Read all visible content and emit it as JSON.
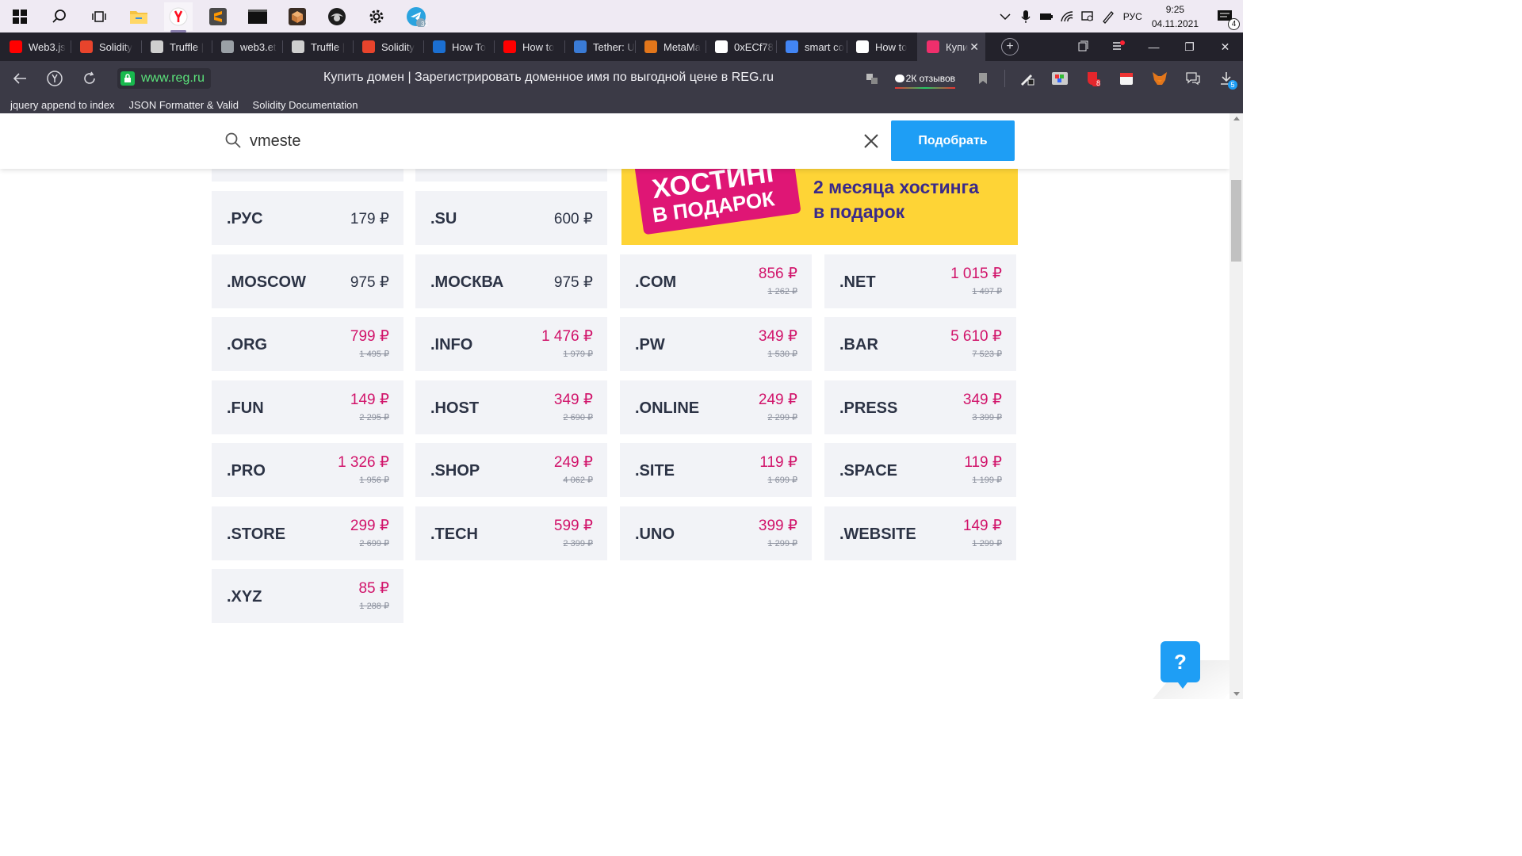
{
  "taskbar": {
    "icons": [
      "windows-start",
      "search",
      "task-view",
      "file-explorer",
      "yandex-browser",
      "sublime-text",
      "terminal",
      "package-app",
      "game-app",
      "settings",
      "telegram"
    ],
    "telegram_badge": "32",
    "tray": {
      "lang": "РУС",
      "time": "9:25",
      "date": "04.11.2021",
      "notifications": "4"
    }
  },
  "tabs": [
    {
      "title": "Web3.js",
      "icon": "youtube-icon",
      "color": "#ff0000"
    },
    {
      "title": "Solidity",
      "icon": "solidity-icon",
      "color": "#e8442c"
    },
    {
      "title": "Truffle |",
      "icon": "truffle-icon",
      "color": "#cfcfcf"
    },
    {
      "title": "web3.et",
      "icon": "doc-icon",
      "color": "#9aa0a6"
    },
    {
      "title": "Truffle |",
      "icon": "truffle-icon",
      "color": "#cfcfcf"
    },
    {
      "title": "Solidity",
      "icon": "solidity-icon",
      "color": "#e8442c"
    },
    {
      "title": "How To",
      "icon": "howto-icon",
      "color": "#1b6fd1"
    },
    {
      "title": "How to",
      "icon": "youtube-icon",
      "color": "#ff0000"
    },
    {
      "title": "Tether: U",
      "icon": "tether-icon",
      "color": "#3a7bd5"
    },
    {
      "title": "MetaMa",
      "icon": "metamask-icon",
      "color": "#e2761b"
    },
    {
      "title": "0xECf78",
      "icon": "ethereum-icon",
      "color": "#ffffff"
    },
    {
      "title": "smart co",
      "icon": "google-icon",
      "color": "#4285f4"
    },
    {
      "title": "How to",
      "icon": "medium-icon",
      "color": "#ffffff"
    },
    {
      "title": "Купи",
      "icon": "regru-icon",
      "color": "#ef2f6c",
      "active": true
    }
  ],
  "address": {
    "url": "www.reg.ru",
    "page_title": "Купить домен | Зарегистрировать доменное имя по выгодной цене в REG.ru",
    "reviews": "2К отзывов",
    "download_badge": "5",
    "ext_badge": "8"
  },
  "bookmarks": [
    "jquery append to index",
    "JSON Formatter & Valid",
    "Solidity Documentation"
  ],
  "search": {
    "value": "vmeste",
    "button": "Подобрать"
  },
  "promo": {
    "sticker_line1": "ХОСТИНГ",
    "sticker_line2": "В ПОДАРОК",
    "text_line1": "2 месяца хостинга",
    "text_line2": "в подарок"
  },
  "domains": [
    {
      "zone": ".РУС",
      "price": "179 ₽"
    },
    {
      "zone": ".SU",
      "price": "600 ₽"
    },
    {
      "zone": ".MOSCOW",
      "price": "975 ₽"
    },
    {
      "zone": ".МОСКВА",
      "price": "975 ₽"
    },
    {
      "zone": ".COM",
      "price": "856 ₽",
      "old": "1 262 ₽"
    },
    {
      "zone": ".NET",
      "price": "1 015 ₽",
      "old": "1 497 ₽"
    },
    {
      "zone": ".ORG",
      "price": "799 ₽",
      "old": "1 495 ₽"
    },
    {
      "zone": ".INFO",
      "price": "1 476 ₽",
      "old": "1 979 ₽"
    },
    {
      "zone": ".PW",
      "price": "349 ₽",
      "old": "1 530 ₽"
    },
    {
      "zone": ".BAR",
      "price": "5 610 ₽",
      "old": "7 523 ₽"
    },
    {
      "zone": ".FUN",
      "price": "149 ₽",
      "old": "2 295 ₽"
    },
    {
      "zone": ".HOST",
      "price": "349 ₽",
      "old": "2 690 ₽"
    },
    {
      "zone": ".ONLINE",
      "price": "249 ₽",
      "old": "2 299 ₽"
    },
    {
      "zone": ".PRESS",
      "price": "349 ₽",
      "old": "3 399 ₽"
    },
    {
      "zone": ".PRO",
      "price": "1 326 ₽",
      "old": "1 956 ₽"
    },
    {
      "zone": ".SHOP",
      "price": "249 ₽",
      "old": "4 062 ₽"
    },
    {
      "zone": ".SITE",
      "price": "119 ₽",
      "old": "1 699 ₽"
    },
    {
      "zone": ".SPACE",
      "price": "119 ₽",
      "old": "1 199 ₽"
    },
    {
      "zone": ".STORE",
      "price": "299 ₽",
      "old": "2 699 ₽"
    },
    {
      "zone": ".TECH",
      "price": "599 ₽",
      "old": "2 399 ₽"
    },
    {
      "zone": ".UNO",
      "price": "399 ₽",
      "old": "1 299 ₽"
    },
    {
      "zone": ".WEBSITE",
      "price": "149 ₽",
      "old": "1 299 ₽"
    },
    {
      "zone": ".XYZ",
      "price": "85 ₽",
      "old": "1 288 ₽"
    }
  ],
  "help_button": "?",
  "colors": {
    "accent": "#1e9ef5",
    "sale": "#d1136a",
    "promo_bg": "#fed436",
    "promo_sticker": "#df1675"
  }
}
